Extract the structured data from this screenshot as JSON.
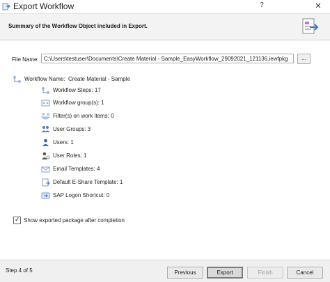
{
  "window": {
    "title": "Export Workflow",
    "help_glyph": "?",
    "close_glyph": "✕"
  },
  "header": {
    "text": "Summary of the Workflow Object included in Export.",
    "icon": "export-document-icon"
  },
  "file": {
    "label": "File Name:",
    "value": "C:\\Users\\testuser\\Documents\\Create Material - Sample_EasyWorkflow_29092021_121136.iewfpkg",
    "browse_label": "..."
  },
  "workflow": {
    "name_label": "Workflow Name:",
    "name_value": "Create Material - Sample"
  },
  "items": [
    {
      "label": "Workflow Steps: 17",
      "icon": "workflow-steps-icon"
    },
    {
      "label": "Workflow group(s): 1",
      "icon": "workflow-group-icon"
    },
    {
      "label": "Filter(s) on work items: 0",
      "icon": "filter-icon"
    },
    {
      "label": "User Groups: 3",
      "icon": "user-groups-icon"
    },
    {
      "label": "Users: 1",
      "icon": "user-icon"
    },
    {
      "label": "User Roles: 1",
      "icon": "user-role-icon"
    },
    {
      "label": "Email Templates: 4",
      "icon": "email-icon"
    },
    {
      "label": "Default E-Share Template: 1",
      "icon": "eshare-template-icon"
    },
    {
      "label": "SAP Logon Shortcut: 0",
      "icon": "sap-logon-icon"
    }
  ],
  "options": {
    "show_after_completion_label": "Show exported package after completion",
    "show_after_completion_checked": true,
    "check_glyph": "✓"
  },
  "footer": {
    "step_label": "Step 4 of 5",
    "previous_label": "Previous",
    "export_label": "Export",
    "finish_label": "Finish",
    "cancel_label": "Cancel"
  },
  "colors": {
    "accent": "#3c78c8",
    "header_bg": "#f3f3f3",
    "footer_bg": "#f0f0f0"
  }
}
